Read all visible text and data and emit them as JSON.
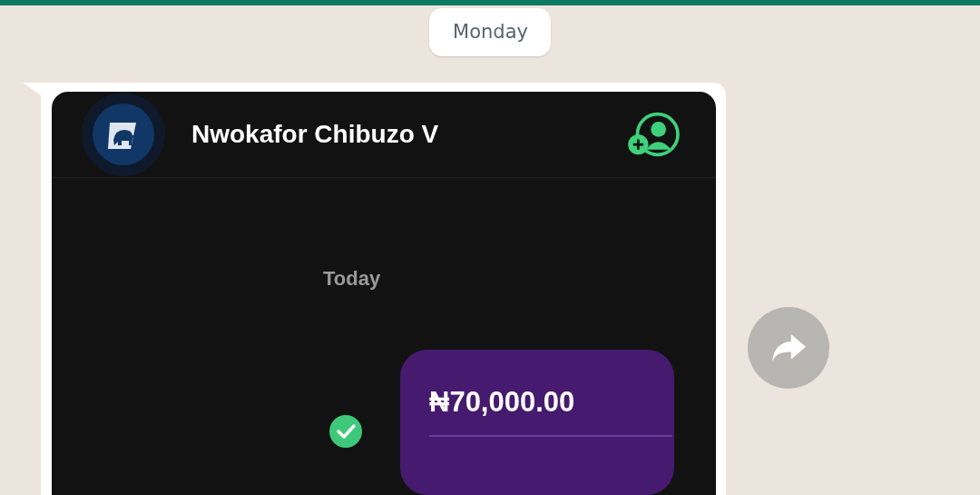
{
  "date_chip": "Monday",
  "shared_image": {
    "header": {
      "contact_name": "Nwokafor Chibuzo V"
    },
    "day_label": "Today",
    "transfer": {
      "amount": "₦70,000.00",
      "succeeded": true
    }
  },
  "forward_button": {
    "visible": true
  }
}
